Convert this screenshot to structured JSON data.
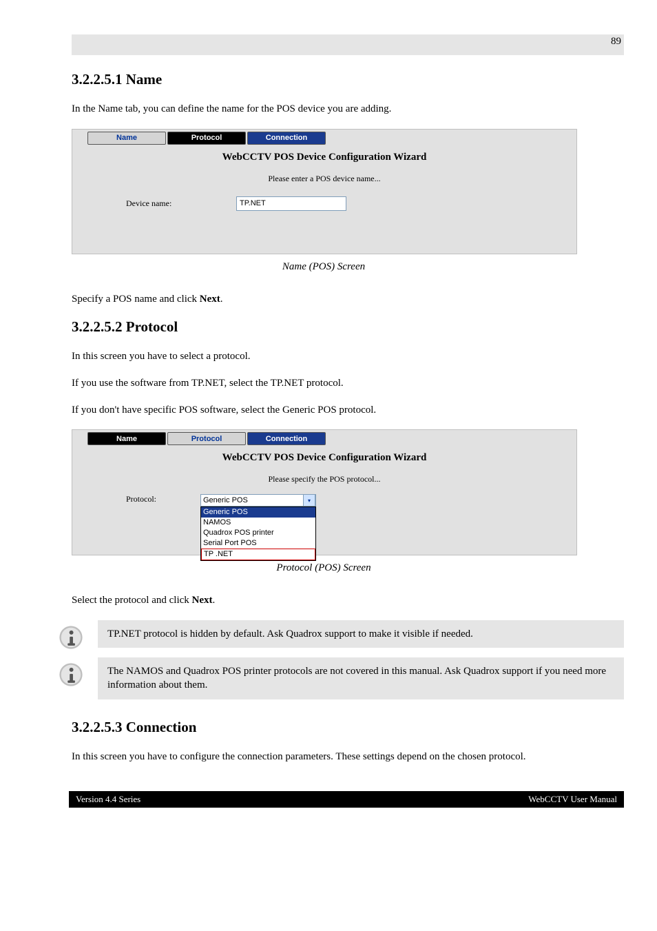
{
  "section3": {
    "heading": "3.2.2.5.1 Name",
    "intro": "In the Name tab, you can define the name for the POS device you are adding."
  },
  "screenshot1": {
    "tab_name": "Name",
    "tab_protocol": "Protocol",
    "tab_connection": "Connection",
    "wizard_title": "WebCCTV POS Device Configuration Wizard",
    "subtitle": "Please enter a POS device name...",
    "label": "Device name:",
    "value": "TP.NET",
    "caption": "Name (POS) Screen"
  },
  "body1": "Specify a POS name and click Next.",
  "section4": {
    "heading": "3.2.2.5.2 Protocol",
    "intro_lines": [
      "In this screen you have to select a protocol.",
      "If you use the software from TP.NET, select the TP.NET protocol.",
      "If you don't have specific POS software, select the Generic POS protocol."
    ]
  },
  "screenshot2": {
    "tab_name": "Name",
    "tab_protocol": "Protocol",
    "tab_connection": "Connection",
    "wizard_title": "WebCCTV POS Device Configuration Wizard",
    "subtitle": "Please specify the POS protocol...",
    "label": "Protocol:",
    "selected": "Generic POS",
    "options": [
      "Generic POS",
      "NAMOS",
      "Quadrox POS printer",
      "Serial Port POS",
      "TP .NET"
    ],
    "caption": "Protocol (POS) Screen"
  },
  "body2": "Select the protocol and click Next.",
  "info1": "TP.NET protocol is hidden by default. Ask Quadrox support to make it visible if needed.",
  "info2": "The NAMOS and Quadrox POS printer protocols are not covered in this manual. Ask Quadrox support if you need more information about them.",
  "section5": {
    "heading": "3.2.2.5.3 Connection",
    "intro": "In this screen you have to configure the connection parameters. These settings depend on the chosen protocol."
  },
  "footer": {
    "left": "Version 4.4 Series",
    "right": "WebCCTV User Manual"
  },
  "page_number": "89"
}
